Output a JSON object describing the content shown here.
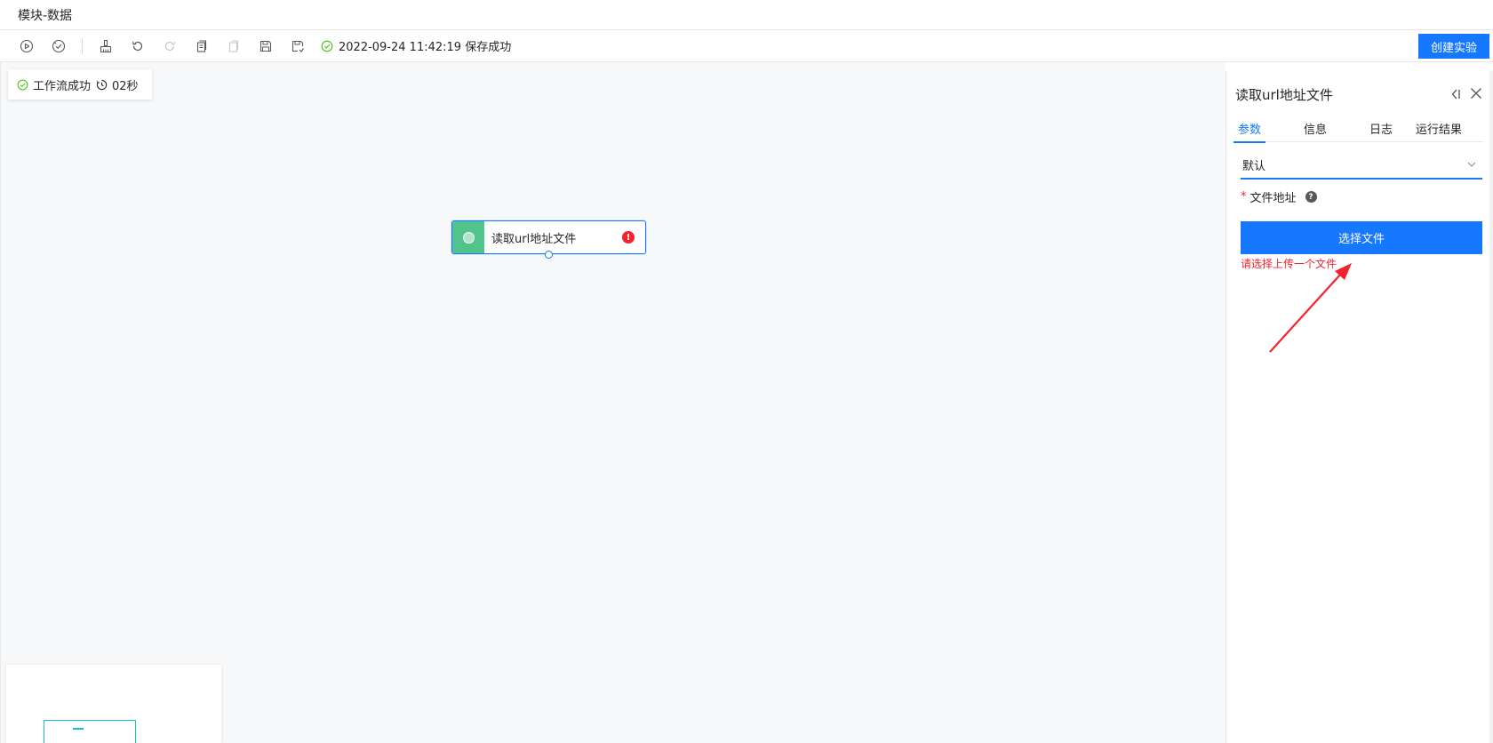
{
  "window": {
    "title": "模块-数据"
  },
  "toolbar": {
    "save_status": "2022-09-24 11:42:19 保存成功",
    "create_experiment_label": "创建实验",
    "icons": [
      "run-icon",
      "check-run-icon",
      "clean-icon",
      "undo-icon",
      "redo-icon",
      "copy-icon",
      "paste-icon",
      "save-icon",
      "save-as-icon"
    ],
    "success_color": "#52c41a"
  },
  "canvas": {
    "workflow_status": "工作流成功",
    "duration": "02秒",
    "node": {
      "label": "读取url地址文件",
      "error_badge": "!",
      "accent_color": "#52c48b"
    }
  },
  "panel": {
    "title": "读取url地址文件",
    "tabs": [
      {
        "label": "参数",
        "active": true
      },
      {
        "label": "信息",
        "active": false
      },
      {
        "label": "日志",
        "active": false
      },
      {
        "label": "运行结果",
        "active": false
      }
    ],
    "select_value": "默认",
    "field": {
      "required_mark": "*",
      "label": "文件地址",
      "help": "?"
    },
    "choose_file_label": "选择文件",
    "error_message": "请选择上传一个文件",
    "primary_color": "#1677ff",
    "error_color": "#f5222d"
  }
}
